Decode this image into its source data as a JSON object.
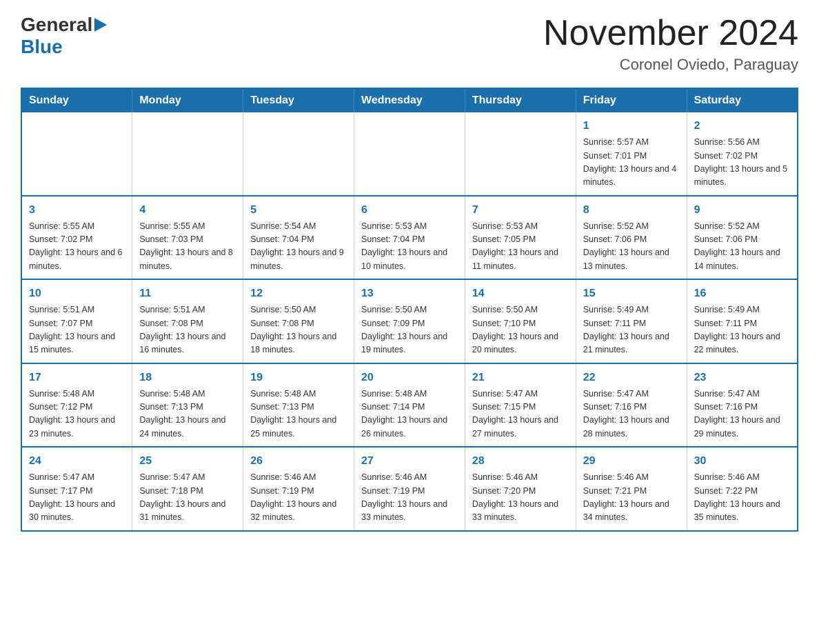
{
  "logo": {
    "general": "General",
    "blue": "Blue",
    "arrow": "▶"
  },
  "header": {
    "month_title": "November 2024",
    "location": "Coronel Oviedo, Paraguay"
  },
  "days_of_week": [
    "Sunday",
    "Monday",
    "Tuesday",
    "Wednesday",
    "Thursday",
    "Friday",
    "Saturday"
  ],
  "weeks": [
    [
      {
        "day": "",
        "info": ""
      },
      {
        "day": "",
        "info": ""
      },
      {
        "day": "",
        "info": ""
      },
      {
        "day": "",
        "info": ""
      },
      {
        "day": "",
        "info": ""
      },
      {
        "day": "1",
        "info": "Sunrise: 5:57 AM\nSunset: 7:01 PM\nDaylight: 13 hours and 4 minutes."
      },
      {
        "day": "2",
        "info": "Sunrise: 5:56 AM\nSunset: 7:02 PM\nDaylight: 13 hours and 5 minutes."
      }
    ],
    [
      {
        "day": "3",
        "info": "Sunrise: 5:55 AM\nSunset: 7:02 PM\nDaylight: 13 hours and 6 minutes."
      },
      {
        "day": "4",
        "info": "Sunrise: 5:55 AM\nSunset: 7:03 PM\nDaylight: 13 hours and 8 minutes."
      },
      {
        "day": "5",
        "info": "Sunrise: 5:54 AM\nSunset: 7:04 PM\nDaylight: 13 hours and 9 minutes."
      },
      {
        "day": "6",
        "info": "Sunrise: 5:53 AM\nSunset: 7:04 PM\nDaylight: 13 hours and 10 minutes."
      },
      {
        "day": "7",
        "info": "Sunrise: 5:53 AM\nSunset: 7:05 PM\nDaylight: 13 hours and 11 minutes."
      },
      {
        "day": "8",
        "info": "Sunrise: 5:52 AM\nSunset: 7:06 PM\nDaylight: 13 hours and 13 minutes."
      },
      {
        "day": "9",
        "info": "Sunrise: 5:52 AM\nSunset: 7:06 PM\nDaylight: 13 hours and 14 minutes."
      }
    ],
    [
      {
        "day": "10",
        "info": "Sunrise: 5:51 AM\nSunset: 7:07 PM\nDaylight: 13 hours and 15 minutes."
      },
      {
        "day": "11",
        "info": "Sunrise: 5:51 AM\nSunset: 7:08 PM\nDaylight: 13 hours and 16 minutes."
      },
      {
        "day": "12",
        "info": "Sunrise: 5:50 AM\nSunset: 7:08 PM\nDaylight: 13 hours and 18 minutes."
      },
      {
        "day": "13",
        "info": "Sunrise: 5:50 AM\nSunset: 7:09 PM\nDaylight: 13 hours and 19 minutes."
      },
      {
        "day": "14",
        "info": "Sunrise: 5:50 AM\nSunset: 7:10 PM\nDaylight: 13 hours and 20 minutes."
      },
      {
        "day": "15",
        "info": "Sunrise: 5:49 AM\nSunset: 7:11 PM\nDaylight: 13 hours and 21 minutes."
      },
      {
        "day": "16",
        "info": "Sunrise: 5:49 AM\nSunset: 7:11 PM\nDaylight: 13 hours and 22 minutes."
      }
    ],
    [
      {
        "day": "17",
        "info": "Sunrise: 5:48 AM\nSunset: 7:12 PM\nDaylight: 13 hours and 23 minutes."
      },
      {
        "day": "18",
        "info": "Sunrise: 5:48 AM\nSunset: 7:13 PM\nDaylight: 13 hours and 24 minutes."
      },
      {
        "day": "19",
        "info": "Sunrise: 5:48 AM\nSunset: 7:13 PM\nDaylight: 13 hours and 25 minutes."
      },
      {
        "day": "20",
        "info": "Sunrise: 5:48 AM\nSunset: 7:14 PM\nDaylight: 13 hours and 26 minutes."
      },
      {
        "day": "21",
        "info": "Sunrise: 5:47 AM\nSunset: 7:15 PM\nDaylight: 13 hours and 27 minutes."
      },
      {
        "day": "22",
        "info": "Sunrise: 5:47 AM\nSunset: 7:16 PM\nDaylight: 13 hours and 28 minutes."
      },
      {
        "day": "23",
        "info": "Sunrise: 5:47 AM\nSunset: 7:16 PM\nDaylight: 13 hours and 29 minutes."
      }
    ],
    [
      {
        "day": "24",
        "info": "Sunrise: 5:47 AM\nSunset: 7:17 PM\nDaylight: 13 hours and 30 minutes."
      },
      {
        "day": "25",
        "info": "Sunrise: 5:47 AM\nSunset: 7:18 PM\nDaylight: 13 hours and 31 minutes."
      },
      {
        "day": "26",
        "info": "Sunrise: 5:46 AM\nSunset: 7:19 PM\nDaylight: 13 hours and 32 minutes."
      },
      {
        "day": "27",
        "info": "Sunrise: 5:46 AM\nSunset: 7:19 PM\nDaylight: 13 hours and 33 minutes."
      },
      {
        "day": "28",
        "info": "Sunrise: 5:46 AM\nSunset: 7:20 PM\nDaylight: 13 hours and 33 minutes."
      },
      {
        "day": "29",
        "info": "Sunrise: 5:46 AM\nSunset: 7:21 PM\nDaylight: 13 hours and 34 minutes."
      },
      {
        "day": "30",
        "info": "Sunrise: 5:46 AM\nSunset: 7:22 PM\nDaylight: 13 hours and 35 minutes."
      }
    ]
  ]
}
